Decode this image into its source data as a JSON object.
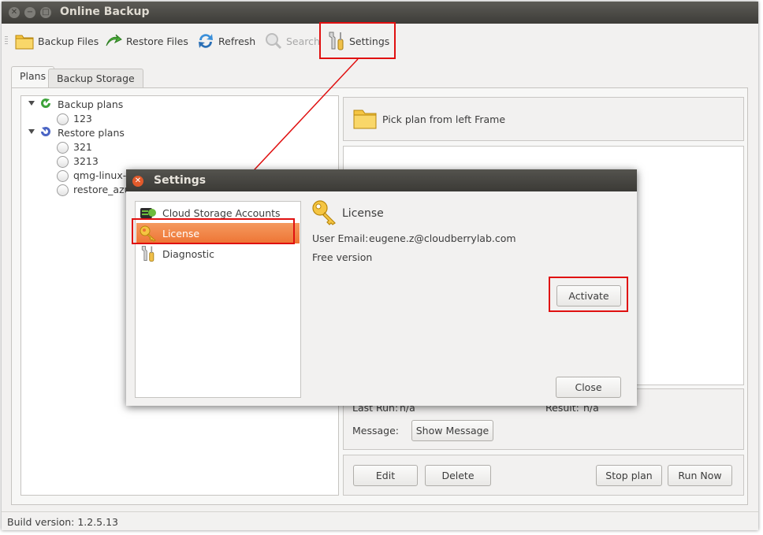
{
  "window": {
    "title": "Online Backup"
  },
  "toolbar": {
    "backup_files": "Backup Files",
    "restore_files": "Restore Files",
    "refresh": "Refresh",
    "search": "Search",
    "settings": "Settings"
  },
  "tabs": [
    {
      "label": "Plans",
      "active": true
    },
    {
      "label": "Backup Storage",
      "active": false
    }
  ],
  "tree": {
    "backup_group": "Backup plans",
    "backup_items": [
      "123"
    ],
    "restore_group": "Restore plans",
    "restore_items": [
      "321",
      "3213",
      "qmg-linux-b",
      "restore_azu"
    ]
  },
  "detail": {
    "pick_plan": "Pick plan from left Frame",
    "last_run_label": "Last Run:",
    "last_run_value": "n/a",
    "result_label": "Result:",
    "result_value": "n/a",
    "message_label": "Message:",
    "show_message": "Show Message",
    "edit": "Edit",
    "delete": "Delete",
    "stop_plan": "Stop plan",
    "run_now": "Run Now"
  },
  "status_bar": {
    "build_version": "Build version: 1.2.5.13"
  },
  "dialog": {
    "title": "Settings",
    "nav": [
      {
        "label": "Cloud Storage Accounts",
        "icon": "cloud-storage-icon"
      },
      {
        "label": "License",
        "icon": "key-icon",
        "selected": true
      },
      {
        "label": "Diagnostic",
        "icon": "tools-icon"
      }
    ],
    "section_title": "License",
    "user_email_label": "User Email:",
    "user_email_value": "eugene.z@cloudberrylab.com",
    "version_text": "Free version",
    "activate_button": "Activate",
    "close_button": "Close"
  },
  "colors": {
    "selection": "#ee7434",
    "highlight_annotation": "#e01010",
    "titlebar": "#3d3c38"
  }
}
